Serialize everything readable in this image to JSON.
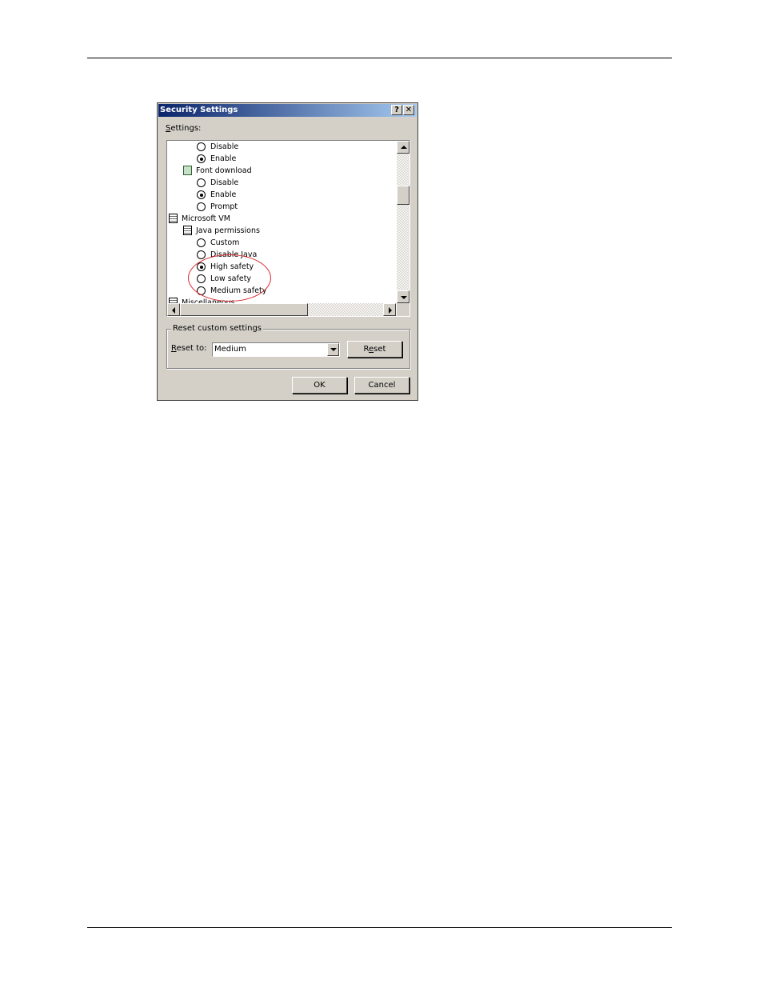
{
  "dialog": {
    "title": "Security Settings",
    "help_button": "?",
    "close_button": "✕",
    "settings_label_underlined": "S",
    "settings_label_rest": "ettings:"
  },
  "settings_list": {
    "items": [
      {
        "kind": "radio",
        "label": "Disable",
        "checked": false
      },
      {
        "kind": "radio",
        "label": "Enable",
        "checked": true
      },
      {
        "kind": "node",
        "label": "Font download",
        "icon": "font-download-icon"
      },
      {
        "kind": "radio",
        "label": "Disable",
        "checked": false
      },
      {
        "kind": "radio",
        "label": "Enable",
        "checked": true
      },
      {
        "kind": "radio",
        "label": "Prompt",
        "checked": false
      },
      {
        "kind": "node",
        "label": "Microsoft VM",
        "icon": "settings-category-icon"
      },
      {
        "kind": "node",
        "label": "Java permissions",
        "icon": "settings-category-icon"
      },
      {
        "kind": "radio",
        "label": "Custom",
        "checked": false
      },
      {
        "kind": "radio",
        "label": "Disable Java",
        "checked": false
      },
      {
        "kind": "radio",
        "label": "High safety",
        "checked": true
      },
      {
        "kind": "radio",
        "label": "Low safety",
        "checked": false
      },
      {
        "kind": "radio",
        "label": "Medium safety",
        "checked": false
      },
      {
        "kind": "node",
        "label": "Miscellaneous",
        "icon": "settings-category-icon"
      }
    ]
  },
  "reset_group": {
    "title": "Reset custom settings",
    "reset_to_underlined": "R",
    "reset_to_rest": "eset to:",
    "selected_value": "Medium",
    "reset_button_pre": "R",
    "reset_button_underlined": "e",
    "reset_button_post": "set"
  },
  "footer": {
    "ok_label": "OK",
    "cancel_label": "Cancel"
  },
  "colors": {
    "highlight_ellipse": "#d9262a",
    "titlebar_start": "#0a246a",
    "titlebar_end": "#a6caf0"
  }
}
